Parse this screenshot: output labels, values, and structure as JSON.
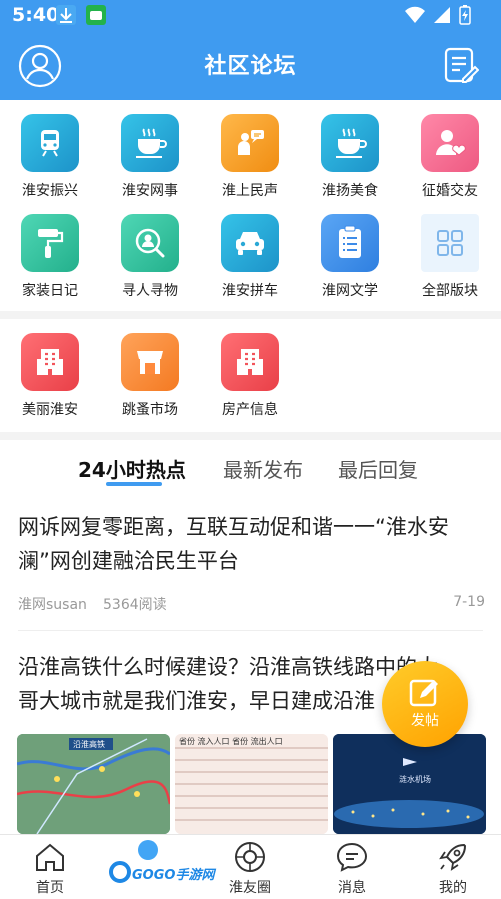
{
  "status": {
    "time": "5:40"
  },
  "header": {
    "title": "社区论坛"
  },
  "grid1": [
    {
      "label": "淮安振兴",
      "icon": "train-icon",
      "color": "#2aa8d6"
    },
    {
      "label": "淮安网事",
      "icon": "coffee-icon",
      "color": "#2aa8d6"
    },
    {
      "label": "淮上民声",
      "icon": "speaker-icon",
      "color": "#f5a623"
    },
    {
      "label": "淮扬美食",
      "icon": "coffee-icon",
      "color": "#2aa8d6"
    },
    {
      "label": "征婚交友",
      "icon": "heart-person-icon",
      "color": "#f06292"
    },
    {
      "label": "家装日记",
      "icon": "paint-roller-icon",
      "color": "#34c2a0"
    },
    {
      "label": "寻人寻物",
      "icon": "search-person-icon",
      "color": "#34c2a0"
    },
    {
      "label": "淮安拼车",
      "icon": "car-icon",
      "color": "#2aa8d6"
    },
    {
      "label": "淮网文学",
      "icon": "document-icon",
      "color": "#3d8be8"
    },
    {
      "label": "全部版块",
      "icon": "grid-icon",
      "color": "#eaf4fd"
    }
  ],
  "grid2": [
    {
      "label": "美丽淮安",
      "icon": "building-icon",
      "color": "#f2545b"
    },
    {
      "label": "跳蚤市场",
      "icon": "shop-icon",
      "color": "#ff8a3d"
    },
    {
      "label": "房产信息",
      "icon": "building-icon",
      "color": "#f2545b"
    }
  ],
  "tabs": [
    "24小时热点",
    "最新发布",
    "最后回复"
  ],
  "posts": [
    {
      "title_line1": "网诉网复零距离，互联互动促和谐一一“淮水安",
      "title_line2": "澜”网创建融洽民生平台",
      "author": "淮网susan",
      "reads": "5364阅读",
      "date": "7-19"
    },
    {
      "title_line1": "沿淮高铁什么时候建设？沿淮高铁线路中的大",
      "title_line2": "哥大城市就是我们淮安，早日建成沿淮"
    }
  ],
  "thumbs": [
    {
      "caption": "沿淮高铁",
      "icon": "map-image"
    },
    {
      "caption": "省份 流入人口 省份 流出人口",
      "icon": "table-image"
    },
    {
      "caption": "涟水机场",
      "icon": "night-city-image"
    }
  ],
  "fab": {
    "label": "发帖"
  },
  "bottomnav": [
    "首页",
    "淮友圈",
    "消息",
    "我的"
  ],
  "watermark": "GOGO手游网",
  "colors": {
    "primary": "#3f9bf0",
    "accent": "#ffb11a"
  }
}
